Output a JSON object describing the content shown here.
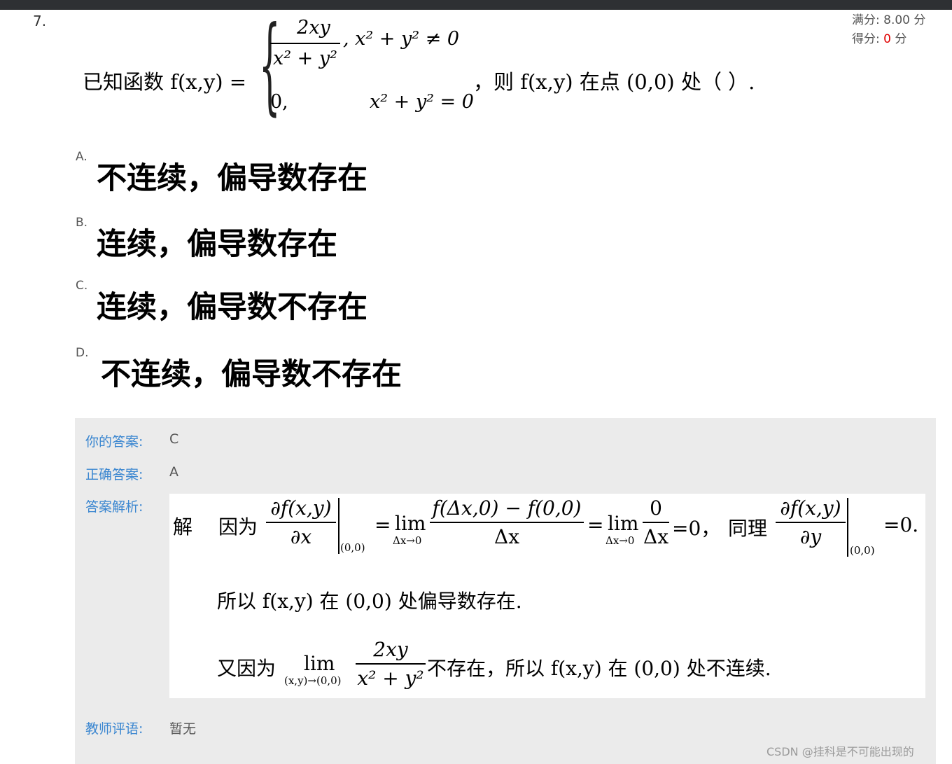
{
  "question": {
    "number": "7.",
    "score_full_label": "满分:",
    "score_full_value": "8.00",
    "score_unit": "分",
    "score_got_label": "得分:",
    "score_got_value": "0",
    "stem_lead": "已知函数 f(x,y) =",
    "case1_num": "2xy",
    "case1_den": "x² + y²",
    "case1_cond": ",   x² + y² ≠ 0",
    "case2_val": "0,",
    "case2_cond": "x² + y² = 0",
    "stem_tail": "，则 f(x,y) 在点 (0,0) 处（          ）."
  },
  "options": [
    {
      "letter": "A.",
      "text": "不连续，偏导数存在"
    },
    {
      "letter": "B.",
      "text": "连续，偏导数存在"
    },
    {
      "letter": "C.",
      "text": "连续，偏导数不存在"
    },
    {
      "letter": "D.",
      "text": "不连续，偏导数不存在"
    }
  ],
  "result": {
    "your_answer_label": "你的答案:",
    "your_answer": "C",
    "correct_answer_label": "正确答案:",
    "correct_answer": "A",
    "analysis_label": "答案解析:",
    "teacher_comment_label": "教师评语:",
    "teacher_comment": "暂无"
  },
  "analysis": {
    "jie": "解",
    "because": "因为",
    "dfdx_num": "∂f(x,y)",
    "dfdx_den": "∂x",
    "at00": "(0,0)",
    "eq": "=",
    "lim": "lim",
    "lim_sub": "Δx→0",
    "lim_frac_num": "f(Δx,0) − f(0,0)",
    "lim_frac_den": "Δx",
    "zero_num": "0",
    "zero_result": "=0，",
    "similarly": "同理",
    "dfdy_num": "∂f(x,y)",
    "dfdy_den": "∂y",
    "zero_end": "=0.",
    "line2": "所以 f(x,y) 在 (0,0) 处偏导数存在.",
    "line3_lead": "又因为",
    "line3_lim_sub": "(x,y)→(0,0)",
    "line3_num": "2xy",
    "line3_den": "x² + y²",
    "line3_tail": "不存在，所以 f(x,y) 在 (0,0) 处不连续."
  },
  "watermark": "CSDN @挂科是不可能出现的"
}
